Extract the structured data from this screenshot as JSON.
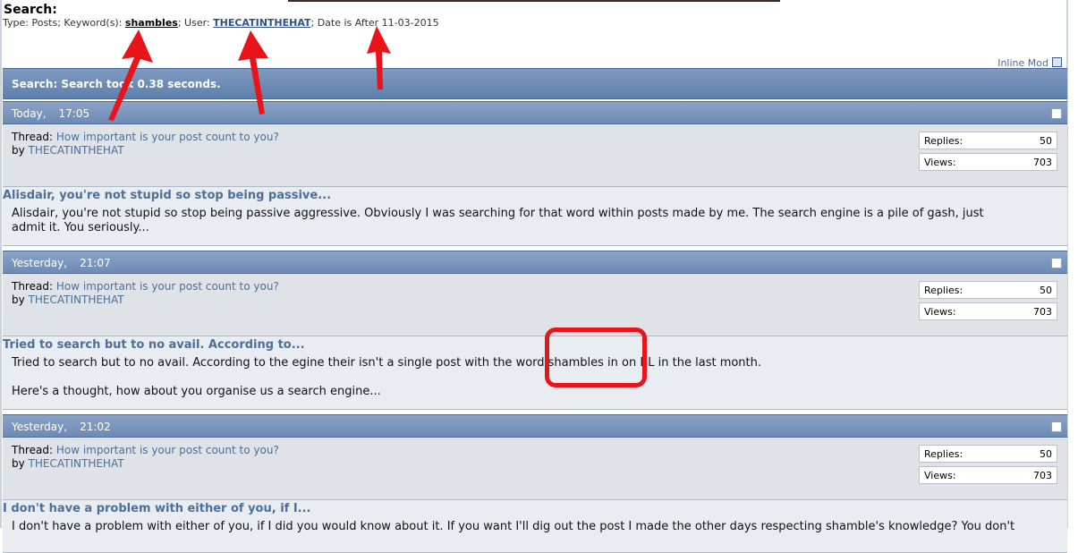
{
  "header": {
    "title": "Search:",
    "criteria_prefix": "Type: Posts; Keyword(s): ",
    "keyword": "shambles",
    "user_prefix": "; User: ",
    "user": "THECATINTHEHAT",
    "date_text": "; Date is After 11-03-2015"
  },
  "inline_mod": {
    "label": "Inline Mod"
  },
  "results_bar": {
    "text": "Search: Search took 0.38 seconds."
  },
  "posts": [
    {
      "date": "Today,",
      "time": "17:05",
      "thread_label": "Thread:",
      "thread_title": "How important is your post count to you?",
      "by_label": "by",
      "author": "THECATINTHEHAT",
      "replies_label": "Replies:",
      "replies": "50",
      "views_label": "Views:",
      "views": "703",
      "title": "Alisdair, you're not stupid so stop being passive...",
      "body": [
        "Alisdair, you're not stupid so stop being passive aggressive. Obviously I was searching for that word within posts made by me. The search engine is a pile of gash, just",
        "admit it. You seriously..."
      ]
    },
    {
      "date": "Yesterday,",
      "time": "21:07",
      "thread_label": "Thread:",
      "thread_title": "How important is your post count to you?",
      "by_label": "by",
      "author": "THECATINTHEHAT",
      "replies_label": "Replies:",
      "replies": "50",
      "views_label": "Views:",
      "views": "703",
      "title": "Tried to search but to no avail. According to...",
      "body": [
        "Tried to search but to no avail. According to the egine their isn't a single post with the word shambles in on BL in the last month.",
        "",
        "Here's a thought, how about you organise us a search engine..."
      ]
    },
    {
      "date": "Yesterday,",
      "time": "21:02",
      "thread_label": "Thread:",
      "thread_title": "How important is your post count to you?",
      "by_label": "by",
      "author": "THECATINTHEHAT",
      "replies_label": "Replies:",
      "replies": "50",
      "views_label": "Views:",
      "views": "703",
      "title": "I don't have a problem with either of you, if I...",
      "body": [
        "I don't have a problem with either of you, if I did you would know about it. If you want I'll dig out the post I made the other days respecting shamble's knowledge? You don't"
      ]
    }
  ],
  "colors": {
    "bar_blue": "#6e8bb5",
    "link_blue": "#4a6f99",
    "annotation_red": "#e8141a"
  }
}
